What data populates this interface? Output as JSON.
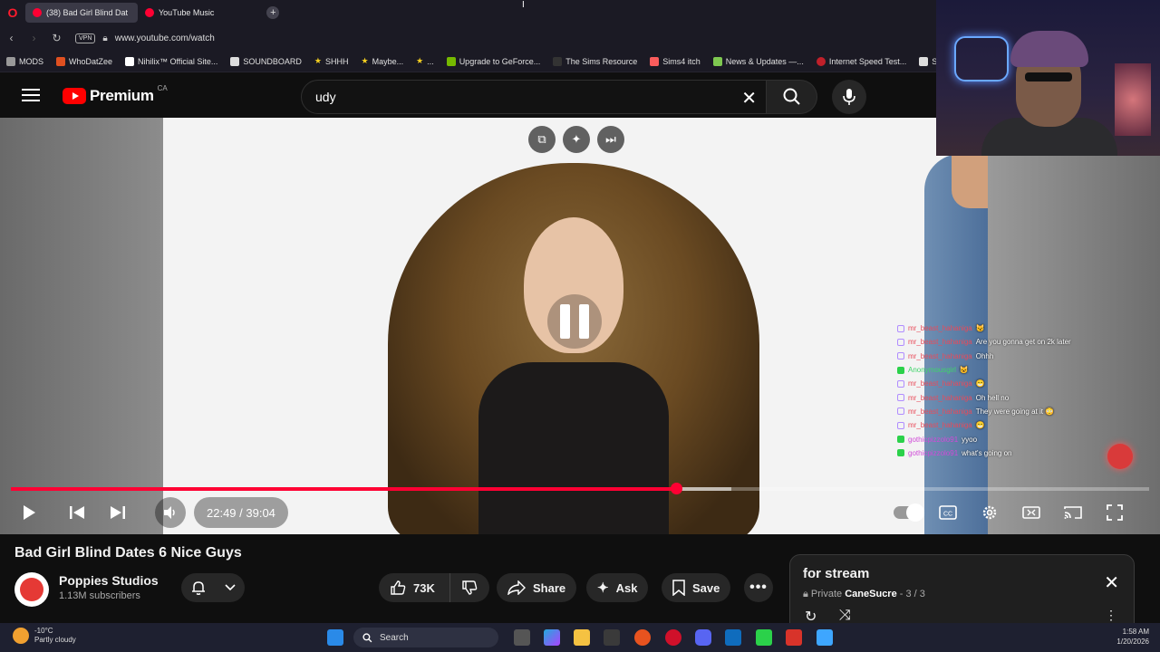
{
  "browser": {
    "tabs": [
      {
        "label": "(38) Bad Girl Blind Dat"
      },
      {
        "label": "YouTube Music"
      }
    ],
    "vpn_label": "VPN",
    "url": "www.youtube.com/watch",
    "bookmarks": [
      "MODS",
      "WhoDatZee",
      "Nihilix™ Official Site...",
      "SOUNDBOARD",
      "SHHH",
      "Maybe...",
      "...",
      "Upgrade to GeForce...",
      "The Sims Resource",
      "Sims4 itch",
      "News & Updates —...",
      "Internet Speed Test...",
      "Servic"
    ]
  },
  "youtube": {
    "logo_text": "Premium",
    "region": "CA",
    "search_value": "udy"
  },
  "player": {
    "current_time": "22:49",
    "duration": "39:04",
    "time_display": "22:49 / 39:04",
    "progress_played": 0.584,
    "progress_loaded": 0.633,
    "chat": [
      {
        "platform": "twitch",
        "user": "mr_beast_hahaniga",
        "msg": "😼"
      },
      {
        "platform": "twitch",
        "user": "mr_beast_hahaniga",
        "msg": "Are you gonna get on 2k later"
      },
      {
        "platform": "twitch",
        "user": "mr_beast_hahaniga",
        "msg": "Ohhh"
      },
      {
        "platform": "kick",
        "user": "Anonymousgirl",
        "msg": "😺"
      },
      {
        "platform": "twitch",
        "user": "mr_beast_hahaniga",
        "msg": "😁"
      },
      {
        "platform": "twitch",
        "user": "mr_beast_hahaniga",
        "msg": "Oh hell no"
      },
      {
        "platform": "twitch",
        "user": "mr_beast_hahaniga",
        "msg": "They were going at it 😳"
      },
      {
        "platform": "twitch",
        "user": "mr_beast_hahaniga",
        "msg": "😁"
      },
      {
        "platform": "kick",
        "user": "gothicpizzolo91",
        "msg": "yyoo"
      },
      {
        "platform": "kick",
        "user": "gothicpizzolo91",
        "msg": "what's going on"
      }
    ]
  },
  "video": {
    "title": "Bad Girl Blind Dates 6 Nice Guys",
    "channel": "Poppies Studios",
    "subscribers": "1.13M subscribers",
    "likes": "73K",
    "share_label": "Share",
    "ask_label": "Ask",
    "save_label": "Save"
  },
  "playlist": {
    "title": "for stream",
    "privacy": "Private",
    "owner": "CaneSucre",
    "position": "- 3 / 3"
  },
  "taskbar": {
    "temperature": "-10°C",
    "weather": "Partly cloudy",
    "search_label": "Search",
    "time": "1:58 AM",
    "date": "1/20/2026"
  },
  "colors": {
    "progress_red": "#ff0033",
    "yt_red": "#ff0000",
    "page_bg": "#0f0f0f"
  }
}
